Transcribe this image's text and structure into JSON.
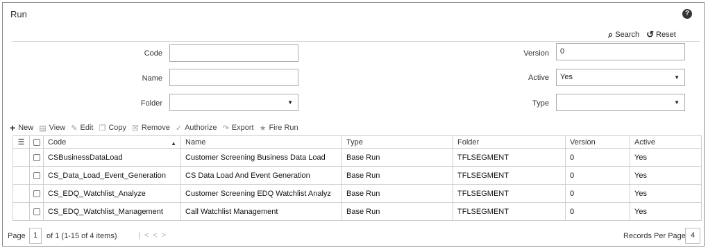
{
  "page": {
    "title": "Run",
    "help_glyph": "?"
  },
  "search_bar": {
    "search_label": "Search",
    "reset_label": "Reset"
  },
  "filters": {
    "code": {
      "label": "Code",
      "value": ""
    },
    "name": {
      "label": "Name",
      "value": ""
    },
    "folder": {
      "label": "Folder",
      "value": ""
    },
    "version": {
      "label": "Version",
      "value": "0"
    },
    "active": {
      "label": "Active",
      "value": "Yes"
    },
    "type": {
      "label": "Type",
      "value": ""
    }
  },
  "toolbar": {
    "new": "New",
    "view": "View",
    "edit": "Edit",
    "copy": "Copy",
    "remove": "Remove",
    "authorize": "Authorize",
    "export": "Export",
    "fire_run": "Fire Run"
  },
  "table": {
    "headers": {
      "code": "Code",
      "name": "Name",
      "type": "Type",
      "folder": "Folder",
      "version": "Version",
      "active": "Active"
    },
    "rows": [
      {
        "code": "CSBusinessDataLoad",
        "name": "Customer Screening Business Data Load",
        "type": "Base Run",
        "folder": "TFLSEGMENT",
        "version": "0",
        "active": "Yes"
      },
      {
        "code": "CS_Data_Load_Event_Generation",
        "name": "CS Data Load And Event Generation",
        "type": "Base Run",
        "folder": "TFLSEGMENT",
        "version": "0",
        "active": "Yes"
      },
      {
        "code": "CS_EDQ_Watchlist_Analyze",
        "name": "Customer Screening EDQ Watchlist Analyz",
        "type": "Base Run",
        "folder": "TFLSEGMENT",
        "version": "0",
        "active": "Yes"
      },
      {
        "code": "CS_EDQ_Watchlist_Management",
        "name": "Call Watchlist Management",
        "type": "Base Run",
        "folder": "TFLSEGMENT",
        "version": "0",
        "active": "Yes"
      }
    ]
  },
  "pager": {
    "page_label": "Page",
    "page_value": "1",
    "of_text": "of 1 (1-15 of 4 items)",
    "records_per_page_label": "Records Per Page",
    "records_per_page_value": "4"
  }
}
